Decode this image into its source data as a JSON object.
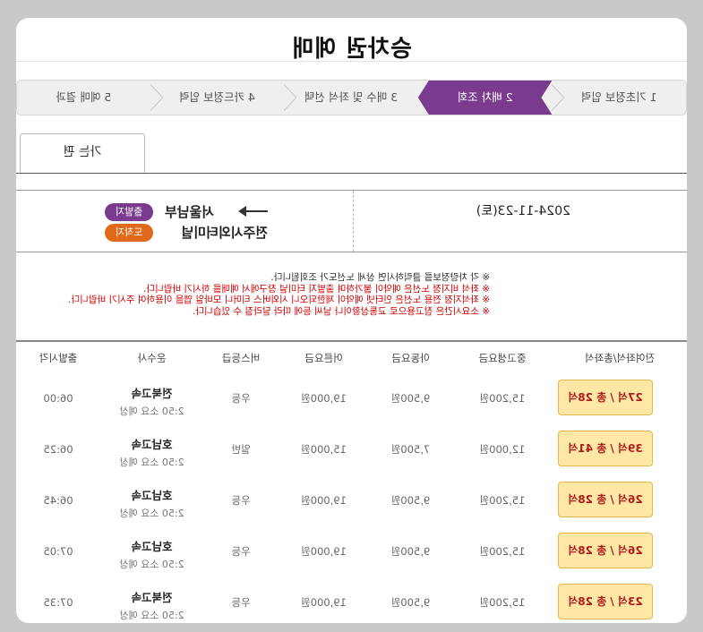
{
  "page_title": "승차권 예매",
  "steps": [
    {
      "label": "1 기초정보 입력",
      "active": false
    },
    {
      "label": "2 배차 조회",
      "active": true
    },
    {
      "label": "3 매수 및 좌석 선택",
      "active": false
    },
    {
      "label": "4 카드정보 입력",
      "active": false
    },
    {
      "label": "5 예매 결과",
      "active": false
    }
  ],
  "tab_label": "가는 편",
  "route": {
    "departure_badge": "출발지",
    "departure": "서울남부",
    "arrival_badge": "도착지",
    "arrival": "전주시외터미널",
    "date": "2024-11-23(토)"
  },
  "notices": [
    {
      "text": "※ 각 차량정보를 클릭하시면 상세 노선도가 조회됩니다.",
      "color": "black"
    },
    {
      "text": "※ 좌석 비지정 노선은 예약이 불가하며 출발지 터미널 창구에서 예매를 하시기 바랍니다.",
      "color": "red"
    },
    {
      "text": "※ 좌석지정 전용 노선은 인터넷 예약이 제한되오니 시외버스 티머니 모바일 앱을 이용하여 주시기 바랍니다.",
      "color": "red"
    },
    {
      "text": "※ 소요시간은 참고용으로 교통상황이나 날씨 등에 따라 달라질 수 있습니다.",
      "color": "red"
    }
  ],
  "table": {
    "headers": {
      "time": "출발시각",
      "company": "운수사",
      "grade": "버스등급",
      "adult": "어른요금",
      "child": "아동요금",
      "teen": "중고생요금",
      "seats": "잔여좌석/총좌석"
    },
    "rows": [
      {
        "time": "06:00",
        "company": "전북고속",
        "duration": "2:50 소요 예상",
        "grade": "우등",
        "adult": "19,000원",
        "child": "9,500원",
        "teen": "15,200원",
        "seats": "27석 / 총 28석"
      },
      {
        "time": "06:25",
        "company": "호남고속",
        "duration": "2:50 소요 예상",
        "grade": "일반",
        "adult": "15,000원",
        "child": "7,500원",
        "teen": "12,000원",
        "seats": "39석 / 총 41석"
      },
      {
        "time": "06:45",
        "company": "호남고속",
        "duration": "2:50 소요 예상",
        "grade": "우등",
        "adult": "19,000원",
        "child": "9,500원",
        "teen": "15,200원",
        "seats": "26석 / 총 28석"
      },
      {
        "time": "07:05",
        "company": "호남고속",
        "duration": "2:50 소요 예상",
        "grade": "우등",
        "adult": "19,000원",
        "child": "9,500원",
        "teen": "15,200원",
        "seats": "26석 / 총 28석"
      },
      {
        "time": "07:35",
        "company": "전북고속",
        "duration": "2:50 소요 예상",
        "grade": "우등",
        "adult": "19,000원",
        "child": "9,500원",
        "teen": "15,200원",
        "seats": "23석 / 총 28석"
      }
    ]
  },
  "colors": {
    "active_step": "#7a3b8f",
    "departure_badge": "#7a3b8f",
    "arrival_badge": "#e06a1a",
    "seat_button_bg": "#ffe7a6",
    "seat_button_text": "#b01a1a",
    "notice_red": "#d20000"
  }
}
